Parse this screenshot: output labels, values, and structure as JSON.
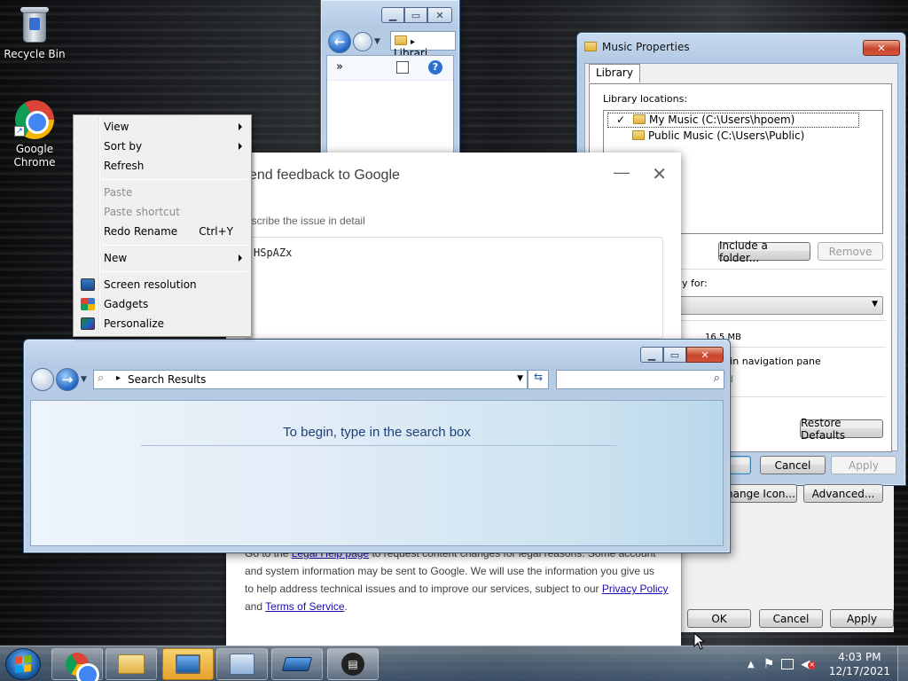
{
  "desktop": {
    "recycle_bin_label": "Recycle Bin",
    "chrome_label_line1": "Google",
    "chrome_label_line2": "Chrome"
  },
  "library_window": {
    "address_text": "Librari",
    "overflow": "»"
  },
  "music_properties": {
    "title": "Music Properties",
    "tab_label": "Library",
    "locations_label": "Library locations:",
    "locations": [
      {
        "check": "✓",
        "text": "My Music (C:\\Users\\hpoem)"
      },
      {
        "check": "",
        "text": "Public Music (C:\\Users\\Public)"
      }
    ],
    "include_folder_button": "Include a folder...",
    "remove_button": "Remove",
    "optimize_label_partial": "y for:",
    "size_label_partial": "16.5 MB",
    "nav_pane_partial": "own in navigation pane",
    "shared_partial": "red",
    "restore_defaults_button": "Restore Defaults",
    "cancel_button": "Cancel",
    "apply_button": "Apply"
  },
  "props_lower": {
    "change_icon_button": "hange Icon...",
    "advanced_button": "Advanced...",
    "ok_button": "OK",
    "cancel_button": "Cancel",
    "apply_button": "Apply"
  },
  "feedback": {
    "title": "end feedback to Google",
    "description_label": "escribe the issue in detail",
    "description_value": "HSpAZx",
    "legal_line1_start": "Go to the ",
    "legal_help_link": "Legal Help page",
    "legal_line1_end": " to request content changes for legal reasons. Some account",
    "legal_line2": "and system information may be sent to Google. We will use the information you give us",
    "legal_line3_start": "to help address technical issues and to improve our services, subject to our ",
    "privacy_link": "Privacy Policy",
    "legal_line4_start": "and ",
    "terms_link": "Terms of Service",
    "legal_line4_end": "."
  },
  "search_window": {
    "address_label": "Search Results",
    "search_placeholder": "",
    "message": "To begin, type in the search box"
  },
  "context_menu": {
    "items": [
      {
        "label": "View",
        "submenu": true
      },
      {
        "label": "Sort by",
        "submenu": true
      },
      {
        "label": "Refresh"
      },
      {
        "label": "Paste",
        "disabled": true
      },
      {
        "label": "Paste shortcut",
        "disabled": true
      },
      {
        "label": "Redo Rename",
        "shortcut": "Ctrl+Y"
      },
      {
        "label": "New",
        "submenu": true
      },
      {
        "label": "Screen resolution"
      },
      {
        "label": "Gadgets"
      },
      {
        "label": "Personalize"
      }
    ]
  },
  "taskbar": {
    "time": "4:03 PM",
    "date": "12/17/2021"
  },
  "colors": {
    "link": "#1a0dab",
    "search_message": "#1e3f7a",
    "taskbar_active": "#e8a12b"
  }
}
